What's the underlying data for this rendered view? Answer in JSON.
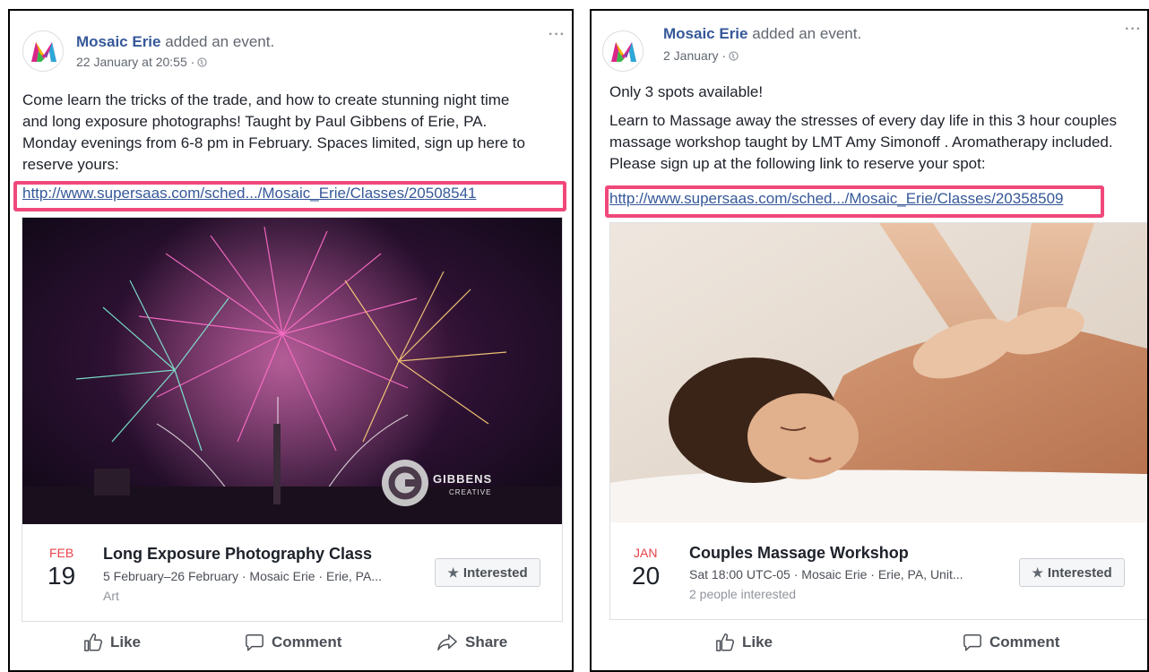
{
  "posts": [
    {
      "author": "Mosaic Erie",
      "action": "added an event.",
      "timestamp": "22 January at 20:55 ·",
      "body": [
        "Come learn the tricks of the trade, and how to create stunning night time",
        "and long exposure photographs! Taught by Paul Gibbens of Erie, PA.",
        "Monday evenings from 6-8 pm in February. Spaces limited, sign up here to",
        "reserve yours:"
      ],
      "link": "http://www.supersaas.com/sched.../Mosaic_Erie/Classes/20508541",
      "image_watermark": {
        "name": "GIBBENS",
        "sub": "CREATIVE"
      },
      "event": {
        "month": "FEB",
        "day": "19",
        "title": "Long Exposure Photography Class",
        "details": "5 February–26 February · Mosaic Erie · Erie, PA...",
        "extra": "Art",
        "interested_label": "Interested"
      },
      "actions": {
        "like": "Like",
        "comment": "Comment",
        "share": "Share"
      }
    },
    {
      "author": "Mosaic Erie",
      "action": "added an event.",
      "timestamp": "2 January ·",
      "body": [
        "Only 3 spots available!",
        "Learn to Massage away the stresses of every day life in this 3 hour couples",
        "massage workshop taught by LMT Amy Simonoff . Aromatherapy included.",
        "Please sign up at the following link to reserve your spot:"
      ],
      "link": "http://www.supersaas.com/sched.../Mosaic_Erie/Classes/20358509",
      "event": {
        "month": "JAN",
        "day": "20",
        "title": "Couples Massage Workshop",
        "details": "Sat 18:00 UTC-05 · Mosaic Erie · Erie, PA, Unit...",
        "extra": "2 people interested",
        "interested_label": "Interested"
      },
      "actions": {
        "like": "Like",
        "comment": "Comment"
      }
    }
  ],
  "icons": {
    "more": "more-options-icon",
    "globe": "globe-icon",
    "star": "star-icon",
    "like": "thumbs-up-icon",
    "comment": "comment-bubble-icon",
    "share": "share-arrow-icon"
  },
  "colors": {
    "link": "#365899",
    "highlight_box": "#f0487a",
    "month": "#e9424b",
    "text": "#1d2129",
    "meta": "#616770"
  }
}
